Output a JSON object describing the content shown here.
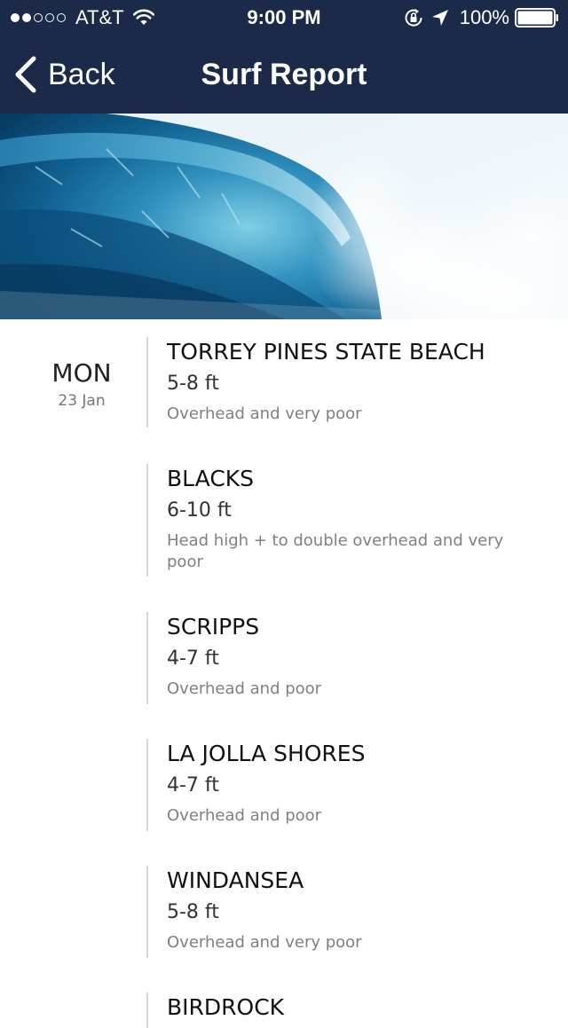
{
  "status_bar": {
    "carrier": "AT&T",
    "time": "9:00 PM",
    "battery_percent": "100%",
    "signal_strength": 2,
    "signal_total": 5,
    "battery_level": 1.0
  },
  "nav": {
    "back_label": "Back",
    "title": "Surf Report"
  },
  "day": {
    "name": "MON",
    "date": "23 Jan"
  },
  "spots": [
    {
      "name": "TORREY PINES STATE BEACH",
      "height": "5-8 ft",
      "description": "Overhead and very poor"
    },
    {
      "name": "BLACKS",
      "height": "6-10 ft",
      "description": "Head high + to double overhead and very poor"
    },
    {
      "name": "SCRIPPS",
      "height": "4-7 ft",
      "description": "Overhead and poor"
    },
    {
      "name": "LA JOLLA SHORES",
      "height": "4-7 ft",
      "description": "Overhead and poor"
    },
    {
      "name": "WINDANSEA",
      "height": "5-8 ft",
      "description": "Overhead and very poor"
    },
    {
      "name": "BIRDROCK",
      "height": "",
      "description": ""
    }
  ],
  "colors": {
    "header_bg": "#1b2a49",
    "divider": "#d8d8d8",
    "secondary_text": "#808080"
  }
}
